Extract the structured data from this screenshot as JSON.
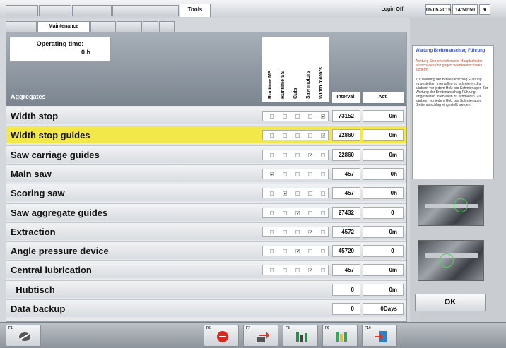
{
  "topbar": {
    "tabs": [
      "",
      "",
      "",
      "",
      "Tools"
    ],
    "login": "Login Off",
    "date": "05.05.2015",
    "time": "14:50:50"
  },
  "subtabs": [
    "",
    "Maintenance",
    "",
    "",
    "",
    ""
  ],
  "header": {
    "operating_time_label": "Operating time:",
    "operating_time_value": "0 h",
    "aggregates_label": "Aggregates",
    "columns": [
      "Runtime MS",
      "Runtime SS",
      "Cuts",
      "Saw motors",
      "Width motors"
    ],
    "interval_label": "Interval:",
    "actual_label": "Act."
  },
  "rows": [
    {
      "name": "Width stop",
      "interval": "73152",
      "actual": "0m",
      "checks": [
        0,
        0,
        0,
        0,
        1
      ],
      "selected": false
    },
    {
      "name": "Width stop guides",
      "interval": "22860",
      "actual": "0m",
      "checks": [
        0,
        0,
        0,
        0,
        1
      ],
      "selected": true
    },
    {
      "name": "Saw carriage guides",
      "interval": "22860",
      "actual": "0m",
      "checks": [
        0,
        0,
        0,
        1,
        0
      ],
      "selected": false
    },
    {
      "name": "Main saw",
      "interval": "457",
      "actual": "0h",
      "checks": [
        1,
        0,
        0,
        0,
        0
      ],
      "selected": false
    },
    {
      "name": "Scoring saw",
      "interval": "457",
      "actual": "0h",
      "checks": [
        0,
        1,
        0,
        0,
        0
      ],
      "selected": false
    },
    {
      "name": "Saw aggregate guides",
      "interval": "27432",
      "actual": "0_",
      "checks": [
        0,
        0,
        1,
        0,
        0
      ],
      "selected": false
    },
    {
      "name": "Extraction",
      "interval": "4572",
      "actual": "0m",
      "checks": [
        0,
        0,
        0,
        1,
        0
      ],
      "selected": false
    },
    {
      "name": "Angle pressure device",
      "interval": "45720",
      "actual": "0_",
      "checks": [
        0,
        0,
        1,
        0,
        0
      ],
      "selected": false
    },
    {
      "name": "Central lubrication",
      "interval": "457",
      "actual": "0m",
      "checks": [
        0,
        0,
        0,
        1,
        0
      ],
      "selected": false
    },
    {
      "name": "_Hubtisch",
      "interval": "0",
      "actual": "0m",
      "checks": null,
      "selected": false
    },
    {
      "name": "Data backup",
      "interval": "0",
      "actual": "0Days",
      "checks": null,
      "selected": false
    }
  ],
  "info": {
    "title": "Wartung Breitenanschlag Führung",
    "warning": "Achtung Sicherheitshinweis! Hauptschalter ausschalten und gegen Wiedereinschalten sichern!",
    "text": "Zur Wartung der Breitenanschlag Führung eingestellten Intervallen zu schmieren. Zu säubern vor jedem Holz pro Schmierlager. Zur Wartung der Breitenanschlag Führung eingestellten Intervallen zu schmieren. Zu säubern vor jedem Holz pro Schmierlager. Breitenanschlag eingestellt werden."
  },
  "ok_label": "OK",
  "fkeys": [
    {
      "label": "F1",
      "icon": "pen-icon"
    },
    {
      "label": "F6",
      "icon": "stop-icon"
    },
    {
      "label": "F7",
      "icon": "transfer-icon"
    },
    {
      "label": "F8",
      "icon": "tree-icon"
    },
    {
      "label": "F9",
      "icon": "green-tree-icon"
    },
    {
      "label": "F10",
      "icon": "exit-icon"
    }
  ],
  "colors": {
    "selected_row": "#f2e84a",
    "accent_blue": "#3a55b5",
    "warning": "#e0401a"
  }
}
